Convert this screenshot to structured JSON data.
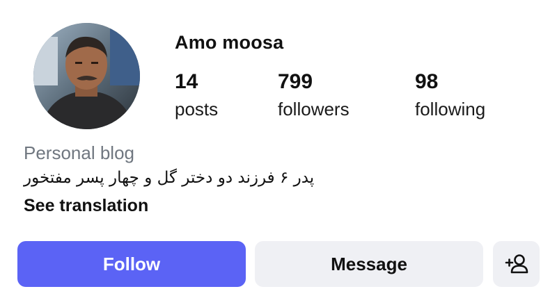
{
  "profile": {
    "username": "Amo moosa",
    "avatar_icon": "profile-photo-man"
  },
  "stats": {
    "posts": {
      "count": "14",
      "label": "posts"
    },
    "followers": {
      "count": "799",
      "label": "followers"
    },
    "following": {
      "count": "98",
      "label": "following"
    }
  },
  "bio": {
    "category": "Personal blog",
    "text": "پدر ۶ فرزند دو دختر گل و چهار پسر مفتخور",
    "translation_link": "See translation"
  },
  "actions": {
    "follow_label": "Follow",
    "message_label": "Message",
    "add_friend_icon": "add-person-icon"
  },
  "colors": {
    "follow_button": "#5b63f5",
    "secondary_button": "#eff0f4",
    "category_text": "#707780"
  }
}
